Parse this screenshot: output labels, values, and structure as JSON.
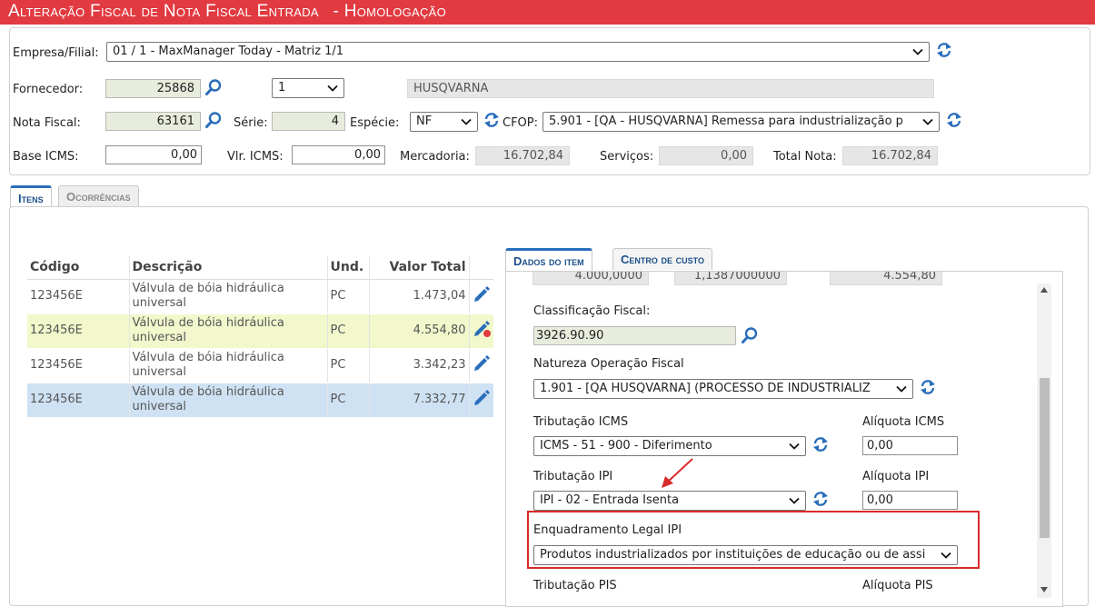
{
  "window": {
    "title": "Alteração Fiscal de Nota Fiscal Entrada",
    "env": "- Homologação"
  },
  "header": {
    "empresa_label": "Empresa/Filial:",
    "empresa_value": "01 / 1 - MaxManager Today - Matriz 1/1",
    "fornecedor_label": "Fornecedor:",
    "fornecedor_code": "25868",
    "fornecedor_select": "1",
    "fornecedor_name": "HUSQVARNA",
    "nota_label": "Nota Fiscal:",
    "nota_value": "63161",
    "serie_label": "Série:",
    "serie_value": "4",
    "especie_label": "Espécie:",
    "especie_value": "NF",
    "cfop_label": "CFOP:",
    "cfop_value": "5.901 - [QA - HUSQVARNA] Remessa para industrialização p",
    "base_icms_label": "Base ICMS:",
    "base_icms_value": "0,00",
    "vlr_icms_label": "Vlr. ICMS:",
    "vlr_icms_value": "0,00",
    "mercadoria_label": "Mercadoria:",
    "mercadoria_value": "16.702,84",
    "servicos_label": "Serviços:",
    "servicos_value": "0,00",
    "total_label": "Total Nota:",
    "total_value": "16.702,84"
  },
  "tabs": {
    "itens": "Itens",
    "ocorrencias": "Ocorrências"
  },
  "items_table": {
    "columns": [
      "Código",
      "Descrição",
      "Und.",
      "Valor Total"
    ],
    "rows": [
      {
        "codigo": "123456E",
        "descricao": "Válvula de bóia hidráulica universal",
        "und": "PC",
        "valor": "1.473,04",
        "highlight": "none"
      },
      {
        "codigo": "123456E",
        "descricao": "Válvula de bóia hidráulica universal",
        "und": "PC",
        "valor": "4.554,80",
        "highlight": "yellow"
      },
      {
        "codigo": "123456E",
        "descricao": "Válvula de bóia hidráulica universal",
        "und": "PC",
        "valor": "3.342,23",
        "highlight": "none"
      },
      {
        "codigo": "123456E",
        "descricao": "Válvula de bóia hidráulica universal",
        "und": "PC",
        "valor": "7.332,77",
        "highlight": "blue"
      }
    ]
  },
  "item_tabs": {
    "dados": "Dados do item",
    "centro": "Centro de custo"
  },
  "item_form": {
    "partial_values": [
      "4.000,0000",
      "1,1387000000",
      "4.554,80"
    ],
    "classificacao_label": "Classificação Fiscal:",
    "classificacao_value": "3926.90.90",
    "natureza_label": "Natureza Operação Fiscal",
    "natureza_value": "1.901 - [QA HUSQVARNA] (PROCESSO DE INDUSTRIALIZ",
    "trib_icms_label": "Tributação ICMS",
    "trib_icms_value": "ICMS - 51 - 900 - Diferimento",
    "aliq_icms_label": "Alíquota ICMS",
    "aliq_icms_value": "0,00",
    "trib_ipi_label": "Tributação IPI",
    "trib_ipi_value": "IPI - 02 - Entrada Isenta",
    "aliq_ipi_label": "Alíquota IPI",
    "aliq_ipi_value": "0,00",
    "enquadramento_label": "Enquadramento Legal IPI",
    "enquadramento_value": "Produtos industrializados por instituições de educação ou de assi",
    "trib_pis_label": "Tributação PIS",
    "aliq_pis_label": "Alíquota PIS"
  },
  "colors": {
    "title_bar": "#e13a40",
    "accent_blue": "#2a6ebb",
    "row_yellow": "#f2f7cc",
    "row_blue": "#cfe2f3",
    "annotation_red": "#d82b2b"
  },
  "icons": {
    "search": "magnifier-icon",
    "refresh": "refresh-icon",
    "edit": "pencil-icon"
  }
}
